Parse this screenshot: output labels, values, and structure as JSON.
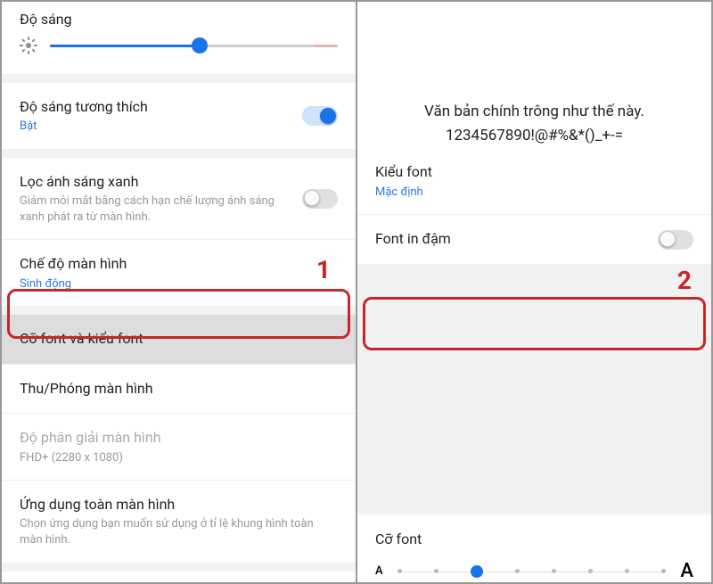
{
  "left": {
    "brightness_label": "Độ sáng",
    "adaptive": {
      "title": "Độ sáng tương thích",
      "status": "Bật"
    },
    "bluelight": {
      "title": "Lọc ánh sáng xanh",
      "desc": "Giảm mỏi mắt bằng cách hạn chế lượng ánh sáng xanh phát ra từ màn hình."
    },
    "screenmode": {
      "title": "Chế độ màn hình",
      "value": "Sinh động"
    },
    "fontsize_style": "Cỡ font và kiểu font",
    "zoom": "Thu/Phóng màn hình",
    "resolution": {
      "title": "Độ phân giải màn hình",
      "value": "FHD+ (2280 x 1080)"
    },
    "fullscreen": {
      "title": "Ứng dụng toàn màn hình",
      "desc": "Chọn ứng dụng bạn muốn sử dụng ở tỉ lệ khung hình toàn màn hình."
    }
  },
  "right": {
    "preview_line1": "Văn bản chính trông như thế này.",
    "preview_line2": "1234567890!@#%&*()_+-=",
    "font_style": {
      "title": "Kiểu font",
      "value": "Mặc định"
    },
    "bold": "Font in đậm",
    "fontsize": "Cỡ font"
  },
  "annotations": {
    "num1": "1",
    "num2": "2"
  }
}
